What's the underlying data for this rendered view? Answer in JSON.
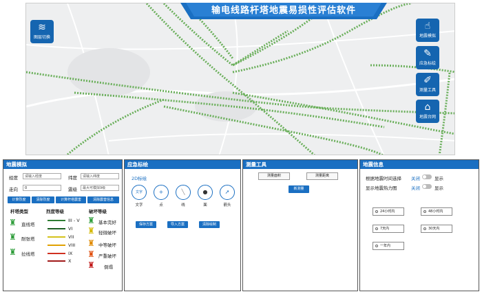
{
  "app": {
    "title": "输电线路杆塔地震易损性评估软件"
  },
  "map_buttons": [
    {
      "label": "图层切换",
      "icon": "layers-icon"
    },
    {
      "label": "地震模拟",
      "icon": "hand-pointer-icon"
    },
    {
      "label": "应急标绘",
      "icon": "pen-draw-icon"
    },
    {
      "label": "测量工具",
      "icon": "ruler-pen-icon"
    },
    {
      "label": "地震台网",
      "icon": "station-house-icon"
    }
  ],
  "quake_sim": {
    "title": "地震模拟",
    "lon_label": "经度",
    "lon_placeholder": "请输入经度",
    "lat_label": "纬度",
    "lat_placeholder": "请输入纬度",
    "dir_label": "走向",
    "dir_value": "0",
    "mag_label": "震级",
    "mag_placeholder": "最大可模拟9级",
    "buttons": [
      "计算烈度",
      "清除烈度",
      "计算杆塔震害",
      "清除震害信息"
    ],
    "tower_type_header": "杆塔类型",
    "intensity_header": "烈度等级",
    "damage_header": "破坏等级",
    "tower_types": [
      "直线塔",
      "耐张塔",
      "拉线塔"
    ],
    "intensities": [
      {
        "label": "III - V",
        "color": "#2e7d32"
      },
      {
        "label": "VI",
        "color": "#1b5e20"
      },
      {
        "label": "VII",
        "color": "#d4c21a"
      },
      {
        "label": "VIII",
        "color": "#e0a000"
      },
      {
        "label": "IX",
        "color": "#d03020"
      },
      {
        "label": "X",
        "color": "#a01818"
      }
    ],
    "damages": [
      {
        "label": "基本完好",
        "color": "#2e9d3a"
      },
      {
        "label": "轻微破坏",
        "color": "#d4b800"
      },
      {
        "label": "中等破坏",
        "color": "#e08a00"
      },
      {
        "label": "严重破坏",
        "color": "#e05010"
      },
      {
        "label": "倒塌",
        "color": "#c01818"
      }
    ]
  },
  "emergency": {
    "title": "应急标绘",
    "subtitle": "2D标绘",
    "tools": [
      "文字",
      "点",
      "线",
      "面",
      "箭头"
    ],
    "tool_glyphs": [
      "文字",
      "+",
      "╲",
      "●",
      "➚"
    ],
    "buttons": [
      "保存方案",
      "导入方案",
      "清除绘制"
    ]
  },
  "measure": {
    "title": "测量工具",
    "area_btn": "测量面积",
    "dist_btn": "测量距离",
    "new_btn": "新测量"
  },
  "quake_info": {
    "title": "地震信息",
    "time_label": "根据地震时间选择",
    "heat_label": "显示地震热力图",
    "off_label": "关闭",
    "show_label": "显示",
    "ranges": [
      "24小时内",
      "48小时内",
      "7天内",
      "30天内",
      "一年内"
    ]
  },
  "colors": {
    "accent": "#1a6fc2",
    "map_line": "#6aaf5a"
  }
}
